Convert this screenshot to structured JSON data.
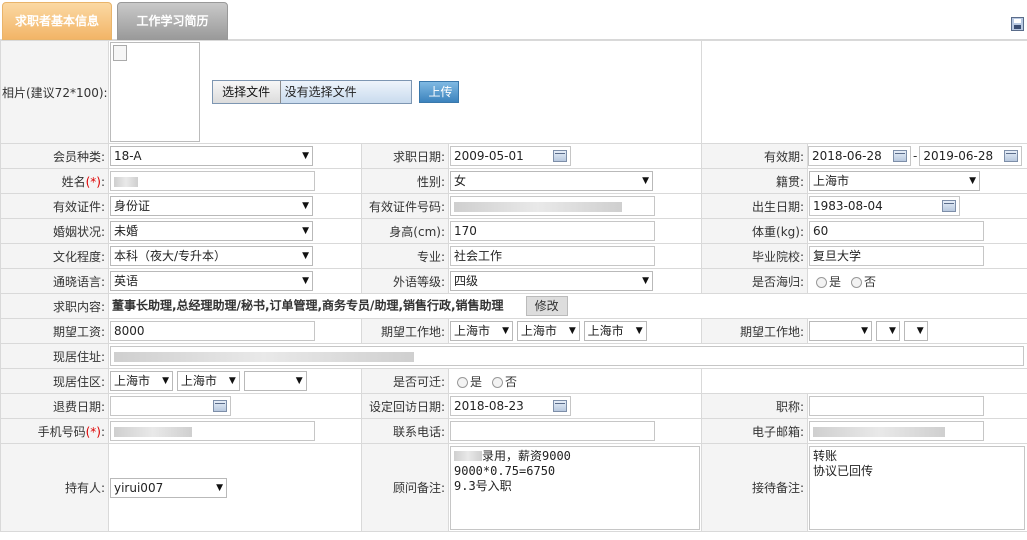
{
  "tabs": [
    {
      "label": "求职者基本信息"
    },
    {
      "label": "工作学习简历"
    }
  ],
  "photo": {
    "label": "相片(建议72*100):",
    "file_button": "选择文件",
    "file_status": "没有选择文件",
    "upload": "上传"
  },
  "row1": {
    "member_label": "会员种类:",
    "member_value": "18-A",
    "apply_date_label": "求职日期:",
    "apply_date": "2009-05-01",
    "valid_label": "有效期:",
    "valid_from": "2018-06-28",
    "dash": "-",
    "valid_to": "2019-06-28"
  },
  "row2": {
    "name_label": "姓名",
    "req": "(*)",
    "colon": ":",
    "gender_label": "性别:",
    "gender": "女",
    "origin_label": "籍贯:",
    "origin": "上海市"
  },
  "row3": {
    "id_label": "有效证件:",
    "id_type": "身份证",
    "id_no_label": "有效证件号码:",
    "birth_label": "出生日期:",
    "birth": "1983-08-04"
  },
  "row4": {
    "marital_label": "婚姻状况:",
    "marital": "未婚",
    "height_label": "身高(cm):",
    "height": "170",
    "weight_label": "体重(kg):",
    "weight": "60"
  },
  "row5": {
    "edu_label": "文化程度:",
    "edu": "本科（夜大/专升本）",
    "major_label": "专业:",
    "major": "社会工作",
    "school_label": "毕业院校:",
    "school": "复旦大学"
  },
  "row6": {
    "lang_label": "通晓语言:",
    "lang": "英语",
    "level_label": "外语等级:",
    "level": "四级",
    "returnee_label": "是否海归:",
    "yes": "是",
    "no": "否"
  },
  "row7": {
    "job_label": "求职内容:",
    "job": "董事长助理,总经理助理/秘书,订单管理,商务专员/助理,销售行政,销售助理",
    "edit": "修改"
  },
  "row8": {
    "salary_label": "期望工资:",
    "salary": "8000",
    "place_label": "期望工作地:",
    "p1": "上海市",
    "p2": "上海市",
    "p3": "上海市",
    "place2_label": "期望工作地:"
  },
  "row9": {
    "addr_label": "现居住址:"
  },
  "row10": {
    "area_label": "现居住区:",
    "a1": "上海市",
    "a2": "上海市",
    "move_label": "是否可迁:",
    "yes": "是",
    "no": "否"
  },
  "row11": {
    "refund_label": "退费日期:",
    "visit_label": "设定回访日期:",
    "visit": "2018-08-23",
    "title_label": "职称:"
  },
  "row12": {
    "mobile_label": "手机号码",
    "req": "(*)",
    "colon": ":",
    "phone_label": "联系电话:",
    "email_label": "电子邮箱:"
  },
  "row13": {
    "owner_label": "持有人:",
    "owner": "yirui007",
    "advisor_label": "顾问备注:",
    "advisor_l1": "录用，薪资9000",
    "advisor_l2": "9000*0.75=6750",
    "advisor_l3": "9.3号入职",
    "reception_label": "接待备注:",
    "reception_l1": "转账",
    "reception_l2": "协议已回传"
  }
}
